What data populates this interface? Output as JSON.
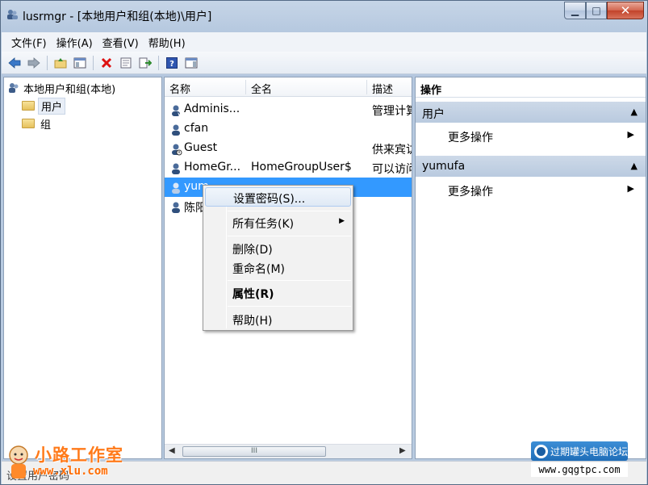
{
  "window": {
    "title": "lusrmgr - [本地用户和组(本地)\\用户]",
    "min_glyph": "▁",
    "max_glyph": "□",
    "close_glyph": "✕"
  },
  "menu": [
    "文件(F)",
    "操作(A)",
    "查看(V)",
    "帮助(H)"
  ],
  "toolbar": {
    "icons": [
      "back-icon",
      "forward-icon",
      "up-folder-icon",
      "show-tree-icon",
      "delete-icon",
      "properties-icon",
      "export-icon",
      "help-icon",
      "show-action-pane-icon"
    ]
  },
  "tree": {
    "root": "本地用户和组(本地)",
    "children": [
      "用户",
      "组"
    ]
  },
  "list": {
    "headers": [
      "名称",
      "全名",
      "描述"
    ],
    "rows": [
      {
        "name": "Adminis...",
        "full_name": "",
        "desc": "管理计算"
      },
      {
        "name": "cfan",
        "full_name": "",
        "desc": ""
      },
      {
        "name": "Guest",
        "full_name": "",
        "desc": "供来宾访"
      },
      {
        "name": "HomeGr...",
        "full_name": "HomeGroupUser$",
        "desc": "可以访问"
      },
      {
        "name": "yum",
        "full_name": "",
        "desc": ""
      },
      {
        "name": "陈阳",
        "full_name": "",
        "desc": ""
      }
    ],
    "scrollbar_thumb": "III",
    "scroll_left": "◀",
    "scroll_right": "▶"
  },
  "actions": {
    "title": "操作",
    "groups": [
      {
        "label": "用户",
        "item": "更多操作"
      },
      {
        "label": "yumufa",
        "item": "更多操作"
      }
    ],
    "collapse_glyph": "▲",
    "submenu_glyph": "▶"
  },
  "context_menu": {
    "items": [
      "设置密码(S)...",
      "所有任务(K)",
      "删除(D)",
      "重命名(M)",
      "属性(R)",
      "帮助(H)"
    ],
    "submenu_glyph": "▶"
  },
  "status": {
    "text": "设置用户密码"
  },
  "watermarks": {
    "left_brand": "小路工作室",
    "left_url": "www.xlu.com",
    "right_badge": "过期罐头电脑论坛",
    "right_url": "www.gqgtpc.com"
  },
  "colors": {
    "selection": "#3399ff",
    "title_bar": "#c6d5e7",
    "close_button": "#c2432a",
    "action_group": "#b9cadf"
  }
}
